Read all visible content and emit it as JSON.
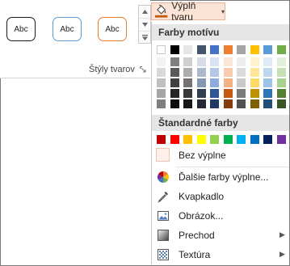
{
  "colors": {
    "accent": "#c55a11",
    "fill_button_bg": "#fbe4d5",
    "section_bg": "#e6e6e6"
  },
  "ribbon": {
    "group_label": "Štýly tvarov",
    "style_gallery": [
      {
        "label": "Abc",
        "border": "#1a1a1a"
      },
      {
        "label": "Abc",
        "border": "#5b9bd5"
      },
      {
        "label": "Abc",
        "border": "#ed7d31"
      }
    ]
  },
  "fill_button": {
    "label": "Výplň tvaru",
    "icon": "paint-bucket-icon",
    "icon_color": "#c55a11"
  },
  "menu": {
    "theme_colors_title": "Farby motívu",
    "theme_colors": [
      [
        "#ffffff",
        "#000000",
        "#e7e6e6",
        "#44546a",
        "#4472c4",
        "#ed7d31",
        "#a5a5a5",
        "#ffc000",
        "#5b9bd5",
        "#70ad47"
      ],
      [
        "#f2f2f2",
        "#808080",
        "#d0cece",
        "#d6dce4",
        "#dae3f3",
        "#fbe5d6",
        "#ededed",
        "#fff2cc",
        "#deebf7",
        "#e2f0d9"
      ],
      [
        "#d9d9d9",
        "#595959",
        "#aeabab",
        "#adb9ca",
        "#b4c7e7",
        "#f8cbad",
        "#dbdbdb",
        "#ffe699",
        "#bdd7ee",
        "#c5e0b4"
      ],
      [
        "#bfbfbf",
        "#404040",
        "#757171",
        "#8497b0",
        "#8faadc",
        "#f4b183",
        "#c9c9c9",
        "#ffd966",
        "#9dc3e6",
        "#a9d18e"
      ],
      [
        "#a6a6a6",
        "#262626",
        "#3a3838",
        "#333f50",
        "#2f5597",
        "#c55a11",
        "#7b7b7b",
        "#bf9000",
        "#2e75b6",
        "#548235"
      ],
      [
        "#7f7f7f",
        "#0d0d0d",
        "#171616",
        "#222a35",
        "#203864",
        "#843c0c",
        "#525252",
        "#7f6000",
        "#1f4e79",
        "#385723"
      ]
    ],
    "standard_colors_title": "Štandardné farby",
    "standard_colors": [
      "#c00000",
      "#ff0000",
      "#ffc000",
      "#ffff00",
      "#92d050",
      "#00b050",
      "#00b0f0",
      "#0070c0",
      "#002060",
      "#7030a0"
    ],
    "items": [
      {
        "label": "Bez výplne",
        "icon": "no-fill-icon"
      },
      {
        "label": "Ďalšie farby výplne...",
        "icon": "color-wheel-icon"
      },
      {
        "label": "Kvapkadlo",
        "icon": "eyedropper-icon"
      },
      {
        "label": "Obrázok...",
        "icon": "picture-icon"
      },
      {
        "label": "Prechod",
        "icon": "gradient-icon",
        "submenu": true
      },
      {
        "label": "Textúra",
        "icon": "texture-icon",
        "submenu": true
      }
    ]
  }
}
